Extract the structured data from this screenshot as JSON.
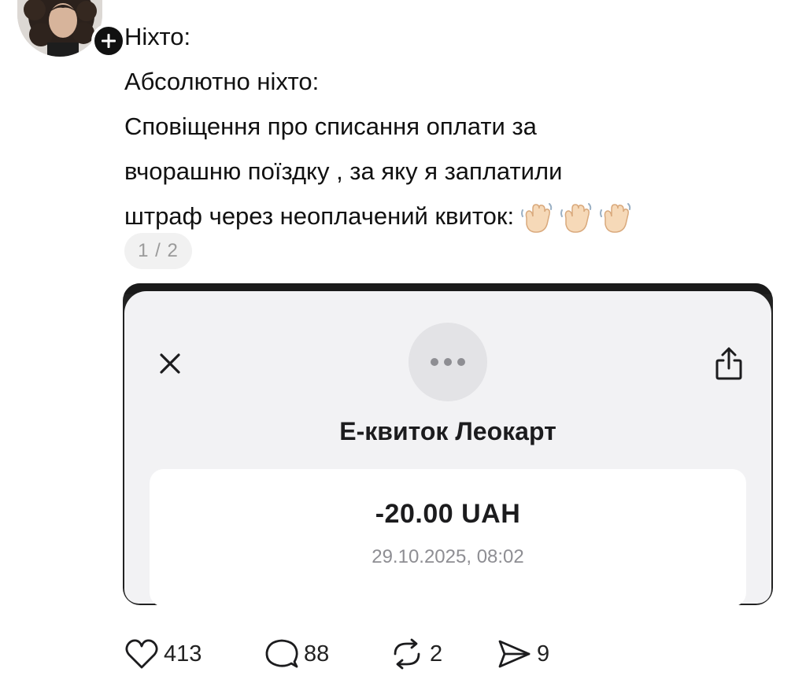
{
  "post": {
    "lines": [
      "Ніхто:",
      "Абсолютно ніхто:",
      "Сповіщення про списання  оплати за",
      "вчорашню поїздку , за яку я заплатили",
      "штраф через неоплачений квиток:"
    ],
    "emoji": [
      "waving-hand",
      "waving-hand",
      "waving-hand"
    ]
  },
  "carousel": {
    "page_indicator": "1 / 2"
  },
  "screenshot": {
    "title": "Е-квиток Леокарт",
    "amount": "-20.00 UAH",
    "datetime": "29.10.2025, 08:02"
  },
  "actions": {
    "likes": "413",
    "replies": "88",
    "reposts": "2",
    "shares": "9"
  },
  "colors": {
    "text": "#111111",
    "muted": "#8e8e93",
    "sheet_bg": "#f2f2f4",
    "card_frame": "#222222"
  }
}
